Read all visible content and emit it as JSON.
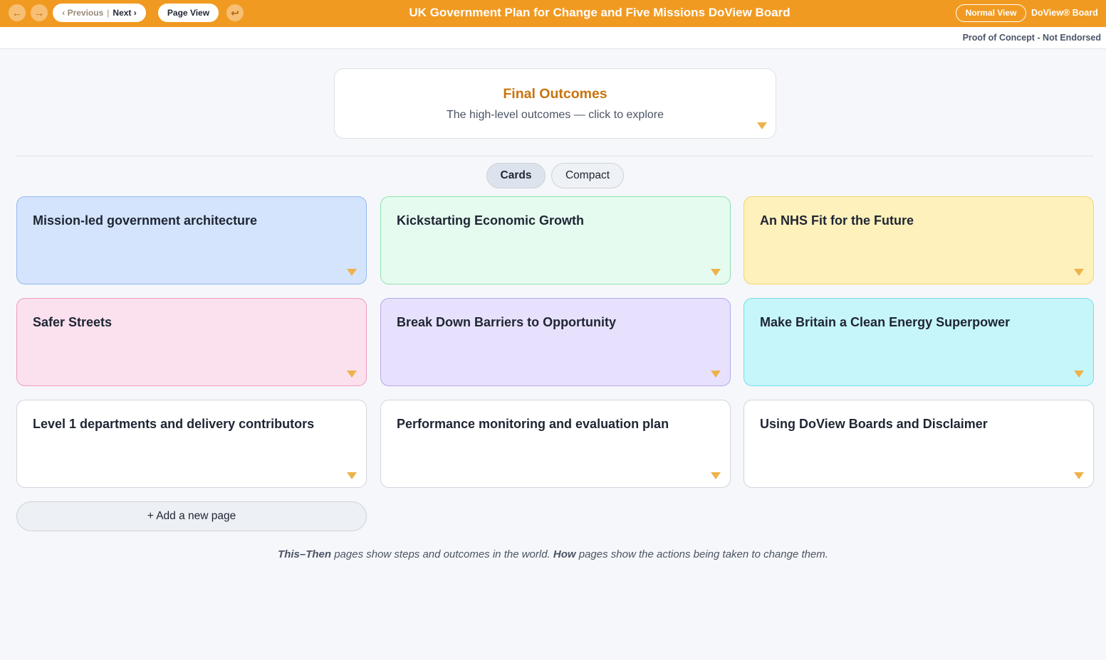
{
  "topbar": {
    "back_icon": "arrow-left-icon",
    "forward_icon": "arrow-right-icon",
    "prev_label": "‹ Previous",
    "separator": "|",
    "next_label": "Next ›",
    "page_view_label": "Page View",
    "undo_icon": "undo-icon",
    "title": "UK Government Plan for Change and Five Missions DoView Board",
    "normal_view_label": "Normal View",
    "brand": "DoView® Board",
    "accent_color": "#f19a21"
  },
  "subbar": {
    "notice": "Proof of Concept - Not Endorsed"
  },
  "final_outcomes": {
    "title": "Final Outcomes",
    "subtitle": "The high-level outcomes — click to explore"
  },
  "view_toggle": {
    "options": [
      "Cards",
      "Compact"
    ],
    "selected": "Cards"
  },
  "cards": [
    {
      "title": "Mission-led government architecture",
      "color": "#d4e4fd"
    },
    {
      "title": "Kickstarting Economic Growth",
      "color": "#e5fbef"
    },
    {
      "title": "An NHS Fit for the Future",
      "color": "#fef1bc"
    },
    {
      "title": "Safer Streets",
      "color": "#fbe0ee"
    },
    {
      "title": "Break Down Barriers to Opportunity",
      "color": "#e7e1fd"
    },
    {
      "title": "Make Britain a Clean Energy Superpower",
      "color": "#c6f6fa"
    },
    {
      "title": "Level 1 departments and delivery contributors",
      "color": "#ffffff"
    },
    {
      "title": "Performance monitoring and evaluation plan",
      "color": "#ffffff"
    },
    {
      "title": "Using DoView Boards and Disclaimer",
      "color": "#ffffff"
    }
  ],
  "add_page_label": "+ Add a new page",
  "footnote": {
    "this_then": "This–Then",
    "part1": " pages show steps and outcomes in the world. ",
    "how": "How",
    "part2": " pages show the actions being taken to change them."
  }
}
